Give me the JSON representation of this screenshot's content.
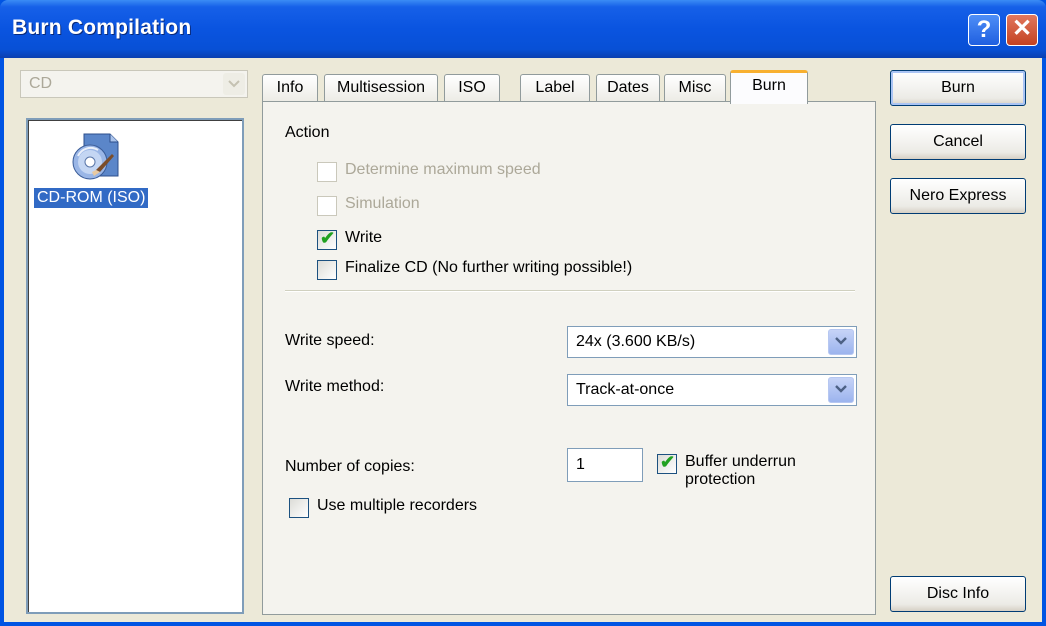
{
  "window": {
    "title": "Burn Compilation"
  },
  "drive_selector": {
    "value": "CD"
  },
  "compilation": {
    "item_label": "CD-ROM (ISO)"
  },
  "tabs": [
    {
      "label": "Info"
    },
    {
      "label": "Multisession"
    },
    {
      "label": "ISO"
    },
    {
      "label": "Label"
    },
    {
      "label": "Dates"
    },
    {
      "label": "Misc"
    },
    {
      "label": "Burn",
      "active": true
    }
  ],
  "burn": {
    "action_title": "Action",
    "determine_speed": {
      "label": "Determine maximum speed",
      "checked": false,
      "disabled": true
    },
    "simulation": {
      "label": "Simulation",
      "checked": false,
      "disabled": true
    },
    "write": {
      "label": "Write",
      "checked": true
    },
    "finalize": {
      "label": "Finalize CD (No further writing possible!)",
      "checked": false
    },
    "write_speed": {
      "label": "Write speed:",
      "value": "24x (3.600 KB/s)"
    },
    "write_method": {
      "label": "Write method:",
      "value": "Track-at-once"
    },
    "copies": {
      "label": "Number of copies:",
      "value": "1"
    },
    "buffer_underrun": {
      "label_line1": "Buffer underrun",
      "label_line2": "protection",
      "checked": true
    },
    "multiple_recorders": {
      "label": "Use multiple recorders",
      "checked": false
    }
  },
  "buttons": {
    "burn": "Burn",
    "cancel": "Cancel",
    "nero_express": "Nero Express",
    "disc_info": "Disc Info"
  },
  "colors": {
    "titlebar": "#0a54e0",
    "face": "#ece9d8",
    "selection": "#316ac5",
    "check": "#21a121"
  },
  "icons": {
    "help": "question-mark-icon",
    "close": "x-close-icon",
    "cd": "cd-rom-disc-icon"
  }
}
